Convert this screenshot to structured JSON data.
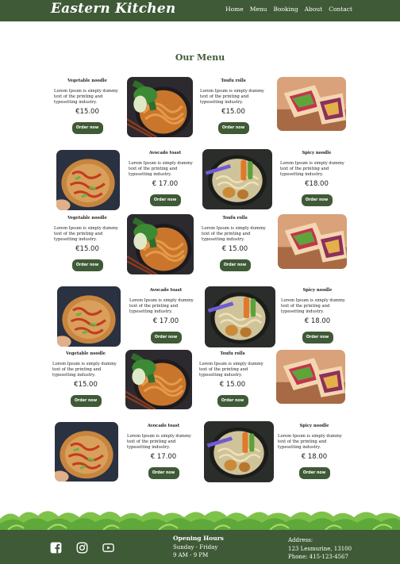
{
  "brand": {
    "name": "Eastern Kitchen"
  },
  "nav": {
    "links": [
      "Home",
      "Menu",
      "Booking",
      "About",
      "Contact"
    ]
  },
  "page": {
    "title": "Our Menu"
  },
  "items": [
    {
      "name": "Vegetable noodle",
      "desc": "Lorem Ipsum is simply dummy text of the printing and typesetting industry.",
      "price": "€15.00",
      "button": "Order now"
    },
    {
      "name": "Toufu rolls",
      "desc": "Lorem Ipsum is simply dummy text of the printing and typesetting industry.",
      "price": "€15.00",
      "button": "Order now"
    },
    {
      "name": "Avocado toast",
      "desc": "Lorem Ipsum is simply dummy text of the printing and typesetting industry.",
      "price": "€ 17.00",
      "button": "Order now"
    },
    {
      "name": "Spicy noodle",
      "desc": "Lorem Ipsum is simply dummy text of the printing and typesetting industry.",
      "price": "€18.00",
      "button": "Order now"
    },
    {
      "name": "Vegetable noodle",
      "desc": "Lorem Ipsum is simply dummy text of the printing and typesetting industry.",
      "price": "€15.00",
      "button": "Order now"
    },
    {
      "name": "Toufu rolls",
      "desc": "Lorem Ipsum is simply dummy text of the printing and typesetting industry.",
      "price": "€ 15.00",
      "button": "Order now"
    },
    {
      "name": "Avocado toast",
      "desc": "Lorem Ipsum is simply dummy text of the printing and typesetting industry.",
      "price": "€ 17.00",
      "button": "Order now"
    },
    {
      "name": "Spicy noodle",
      "desc": "Lorem Ipsum is simply dummy text of the printing and typesetting industry.",
      "price": "€ 18.00",
      "button": "Order now"
    },
    {
      "name": "Vegetable noodle",
      "desc": "Lorem Ipsum is simply dummy text of the printing and typesetting industry.",
      "price": "€15.00",
      "button": "Order now"
    },
    {
      "name": "Toufu rolls",
      "desc": "Lorem Ipsum is simply dummy text of the printing and typesetting industry.",
      "price": "€ 15.00",
      "button": "Order now"
    },
    {
      "name": "Avocado toast",
      "desc": "Lorem Ipsum is simply dummy text of the printing and typesetting industry.",
      "price": "€ 17.00",
      "button": "Order now"
    },
    {
      "name": "Spicy noodle",
      "desc": "Lorem Ipsum is simply dummy text of the printing and typesetting industry.",
      "price": "€ 18.00",
      "button": "Order now"
    }
  ],
  "footer": {
    "social_icons": [
      "facebook-icon",
      "instagram-icon",
      "youtube-icon"
    ],
    "hours_title": "Opening Hours",
    "hours_days": "Sunday - Friday",
    "hours_time": "9 AM - 9 PM",
    "address_title": "Address:",
    "address_line": "123 Lesmurine, 13100",
    "phone": "Phone: 415-123-4567"
  },
  "colors": {
    "brand_green": "#3f5a36",
    "background": "#ffffff"
  }
}
